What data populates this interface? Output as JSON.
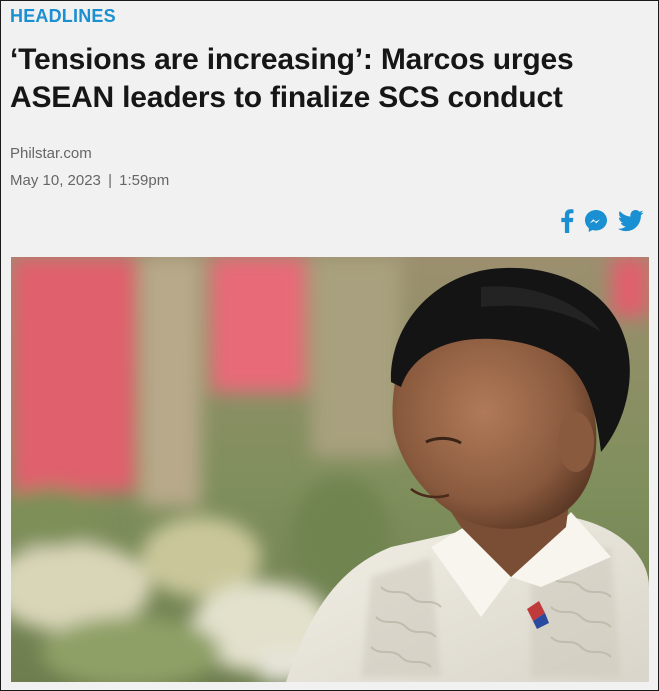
{
  "article": {
    "category": "HEADLINES",
    "title": "‘Tensions are increasing’: Marcos urges ASEAN leaders to finalize SCS conduct",
    "source": "Philstar.com",
    "date": "May 10, 2023",
    "separator": "|",
    "time": "1:59pm"
  },
  "share": {
    "icons": [
      "facebook-icon",
      "messenger-icon",
      "twitter-icon"
    ],
    "brand_color": "#1a8fd1"
  },
  "photo": {
    "subject": "news-photo"
  },
  "colors": {
    "accent": "#1a8fd1",
    "headline": "#161616",
    "meta": "#666666",
    "card_background": "#f1f1f1"
  }
}
